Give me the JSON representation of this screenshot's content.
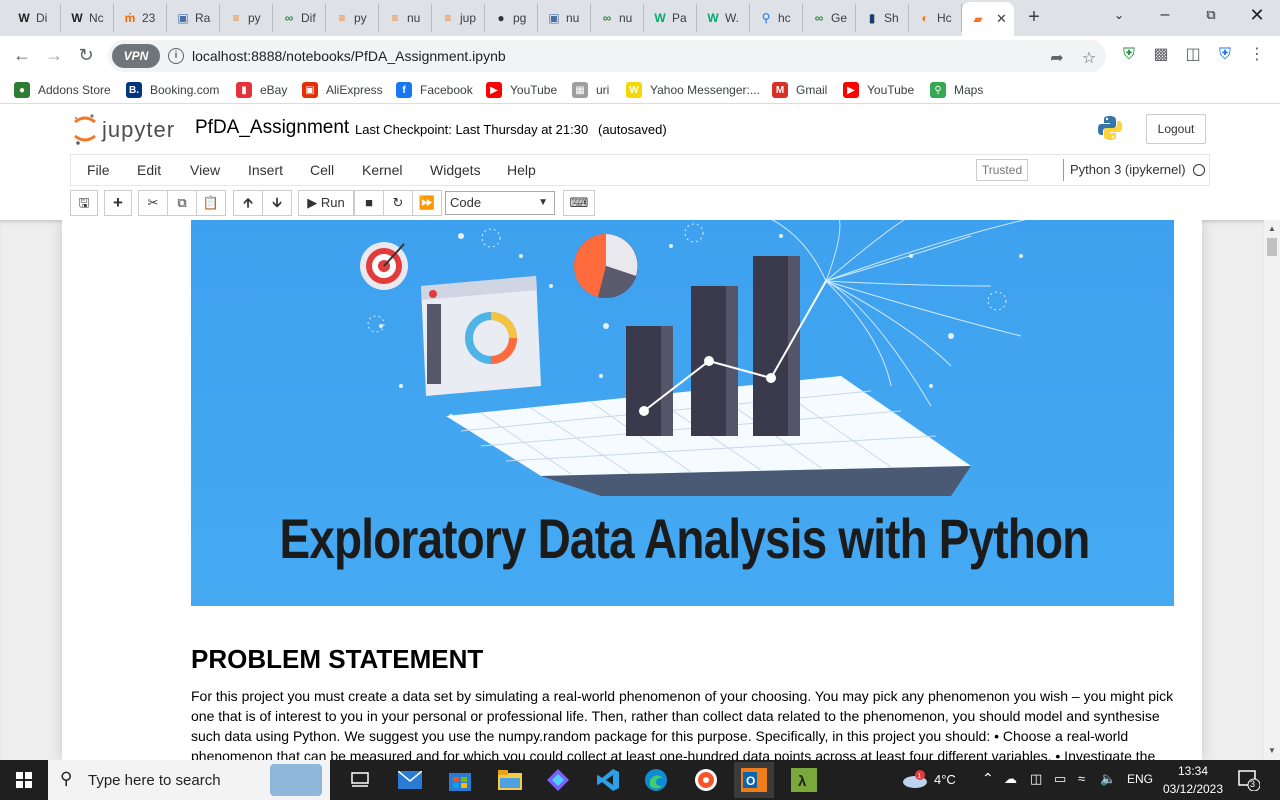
{
  "browser": {
    "tabs": [
      {
        "label": "Di",
        "icon": "wikipedia-icon"
      },
      {
        "label": "Nc",
        "icon": "wikipedia-icon"
      },
      {
        "label": "23",
        "icon": "hn-icon"
      },
      {
        "label": "Ra",
        "icon": "cube-icon"
      },
      {
        "label": "py",
        "icon": "stackoverflow-icon"
      },
      {
        "label": "Dif",
        "icon": "geeks-icon"
      },
      {
        "label": "py",
        "icon": "stackoverflow-icon"
      },
      {
        "label": "nu",
        "icon": "stackoverflow-icon"
      },
      {
        "label": "jup",
        "icon": "stackoverflow-icon"
      },
      {
        "label": "pg",
        "icon": "github-icon"
      },
      {
        "label": "nu",
        "icon": "cube-icon"
      },
      {
        "label": "nu",
        "icon": "geeks-icon"
      },
      {
        "label": "Pa",
        "icon": "w3-icon"
      },
      {
        "label": "W.",
        "icon": "w3-icon"
      },
      {
        "label": "hc",
        "icon": "search-icon"
      },
      {
        "label": "Ge",
        "icon": "geeks-icon"
      },
      {
        "label": "Sh",
        "icon": "bookmark-icon"
      },
      {
        "label": "Hc",
        "icon": "jupyter-icon"
      }
    ],
    "url": "localhost:8888/notebooks/PfDA_Assignment.ipynb",
    "vpn_label": "VPN",
    "bookmarks": [
      {
        "label": "Addons Store",
        "color": "#2e7d32"
      },
      {
        "label": "Booking.com",
        "color": "#003580"
      },
      {
        "label": "eBay",
        "color": "#e53238"
      },
      {
        "label": "AliExpress",
        "color": "#e62e04"
      },
      {
        "label": "Facebook",
        "color": "#1877f2"
      },
      {
        "label": "YouTube",
        "color": "#ff0000"
      },
      {
        "label": "uri",
        "color": "#9e9e9e"
      },
      {
        "label": "Yahoo Messenger:...",
        "color": "#f5d800"
      },
      {
        "label": "Gmail",
        "color": "#d93025"
      },
      {
        "label": "YouTube",
        "color": "#ff0000"
      },
      {
        "label": "Maps",
        "color": "#34a853"
      }
    ]
  },
  "jupyter": {
    "logo_text": "jupyter",
    "notebook_name": "PfDA_Assignment",
    "checkpoint": "Last Checkpoint: Last Thursday at 21:30",
    "autosave": "(autosaved)",
    "logout_label": "Logout",
    "menus": [
      "File",
      "Edit",
      "View",
      "Insert",
      "Cell",
      "Kernel",
      "Widgets",
      "Help"
    ],
    "trusted_label": "Trusted",
    "kernel_name": "Python 3 (ipykernel)",
    "run_label": "Run",
    "cell_type": "Code"
  },
  "notebook": {
    "banner_title": "Exploratory Data Analysis with Python",
    "heading": "PROBLEM STATEMENT",
    "paragraph": "For this project you must create a data set by simulating a real-world phenomenon of your choosing. You may pick any phenomenon you wish – you might pick one that is of interest to you in your personal or professional life. Then, rather than collect data related to the phenomenon, you should model and synthesise such data using Python. We suggest you use the numpy.random package for this purpose. Specifically, in this project you should: • Choose a real-world phenomenon that can be measured and for which you could collect at least one-hundred data points across at least four different variables. • Investigate the"
  },
  "taskbar": {
    "search_placeholder": "Type here to search",
    "weather": "4°C",
    "weather_badge": "1",
    "language": "ENG",
    "time": "13:34",
    "date": "03/12/2023",
    "notification_count": "3"
  }
}
